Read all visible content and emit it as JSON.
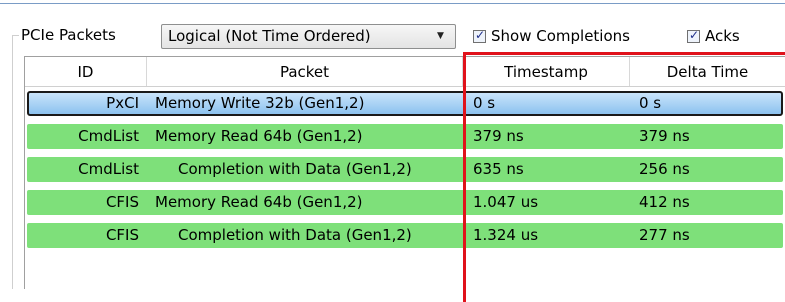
{
  "toolbar": {
    "label": "PCIe Packets",
    "view_mode_value": "Logical (Not Time Ordered)",
    "show_completions_label": "Show Completions",
    "show_completions_checked": true,
    "acks_label": "Acks",
    "acks_checked": true
  },
  "table": {
    "headers": [
      "ID",
      "Packet",
      "Timestamp",
      "Delta Time"
    ],
    "rows": [
      {
        "id": "PxCI",
        "packet": "Memory Write 32b (Gen1,2)",
        "timestamp": "0 s",
        "delta": "0 s",
        "state": "selected",
        "indent": false
      },
      {
        "id": "CmdList",
        "packet": "Memory Read 64b (Gen1,2)",
        "timestamp": "379 ns",
        "delta": "379 ns",
        "state": "normal",
        "indent": false
      },
      {
        "id": "CmdList",
        "packet": "Completion with Data (Gen1,2)",
        "timestamp": "635 ns",
        "delta": "256 ns",
        "state": "normal",
        "indent": true
      },
      {
        "id": "CFIS",
        "packet": "Memory Read 64b (Gen1,2)",
        "timestamp": "1.047 us",
        "delta": "412 ns",
        "state": "normal",
        "indent": false
      },
      {
        "id": "CFIS",
        "packet": "Completion with Data (Gen1,2)",
        "timestamp": "1.324 us",
        "delta": "277 ns",
        "state": "normal",
        "indent": true
      }
    ]
  },
  "colors": {
    "row_green": "#7ee07a",
    "row_selected": "#8cc2ef",
    "highlight_border": "#e0121b"
  }
}
